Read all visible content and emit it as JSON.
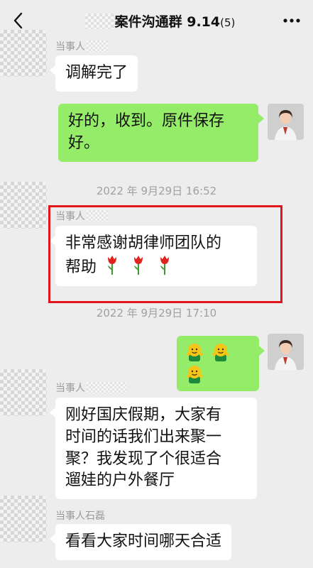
{
  "header": {
    "title": "案件沟通群 9.14",
    "member_count": "(5)"
  },
  "messages": {
    "m1": {
      "sender": "当事人",
      "text": "调解完了"
    },
    "m2": {
      "line1": "好的，收到。原件保存",
      "line2": "好。"
    },
    "time1": "2022 年 9月29日 16:52",
    "m3": {
      "sender": "当事人",
      "line1": "非常感谢胡律师团队的",
      "line2": "帮助"
    },
    "time2": "2022 年 9月29日 17:10",
    "m5": {
      "sender": "当事人",
      "line1": "刚好国庆假期，大家有",
      "line2": "时间的话我们出来聚一",
      "line3": "聚？我发现了个很适合",
      "line4": "遛娃的户外餐厅"
    },
    "m6": {
      "sender": "当事人石磊",
      "text": "看看大家时间哪天合适"
    }
  },
  "colors": {
    "outgoing_bubble": "#95ec69",
    "incoming_bubble": "#ffffff",
    "highlight": "#e0161c",
    "background": "#ededed"
  },
  "icons": {
    "back": "chevron-left-icon",
    "more": "more-dots-icon",
    "tulip": "tulip-emoji-icon",
    "smiley": "smiley-emoji-icon"
  }
}
